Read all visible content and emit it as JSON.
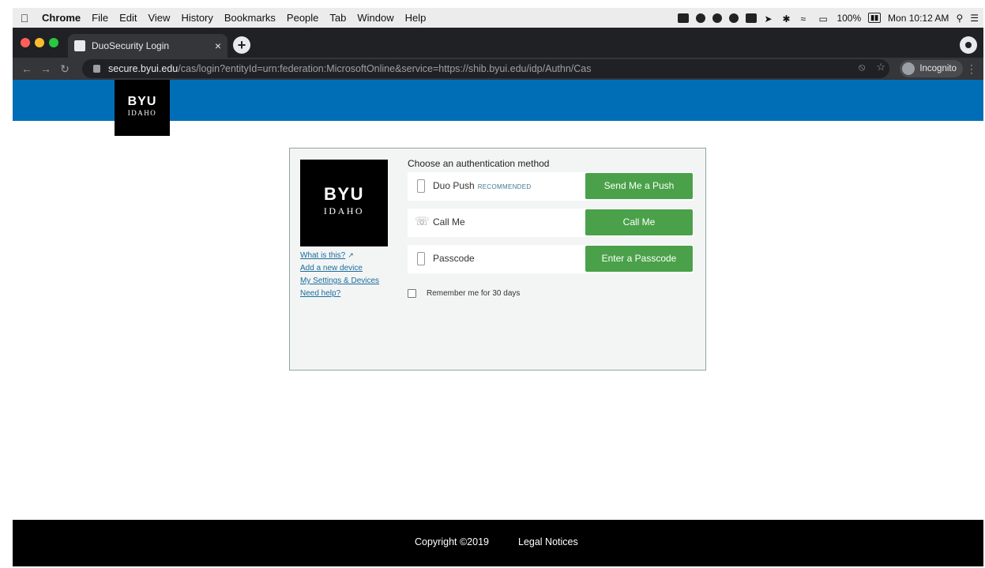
{
  "menubar": {
    "app": "Chrome",
    "items": [
      "File",
      "Edit",
      "View",
      "History",
      "Bookmarks",
      "People",
      "Tab",
      "Window",
      "Help"
    ],
    "battery_percent": "100%",
    "clock": "Mon 10:12 AM"
  },
  "browser": {
    "tab_title": "DuoSecurity Login",
    "tab_close": "×",
    "new_tab": "+",
    "url_host": "secure.byui.edu",
    "url_rest": "/cas/login?entityId=urn:federation:MicrosoftOnline&service=https://shib.byui.edu/idp/Authn/Cas",
    "incognito_label": "Incognito"
  },
  "header_logo": {
    "line1": "BYU",
    "line2": "IDAHO"
  },
  "duo": {
    "logo": {
      "line1": "BYU",
      "line2": "IDAHO"
    },
    "links": {
      "what_is_this": "What is this?",
      "add_device": "Add a new device",
      "settings": "My Settings & Devices",
      "help": "Need help?"
    },
    "title": "Choose an authentication method",
    "methods": [
      {
        "label": "Duo Push",
        "tag": "RECOMMENDED",
        "button": "Send Me a Push"
      },
      {
        "label": "Call Me",
        "tag": "",
        "button": "Call Me"
      },
      {
        "label": "Passcode",
        "tag": "",
        "button": "Enter a Passcode"
      }
    ],
    "remember": "Remember me for 30 days",
    "remember_checked": false
  },
  "footer": {
    "copyright": "Copyright ©2019",
    "legal": "Legal Notices"
  },
  "colors": {
    "brand_blue": "#006eb6",
    "button_green": "#4aa149",
    "footer": "#000000"
  }
}
